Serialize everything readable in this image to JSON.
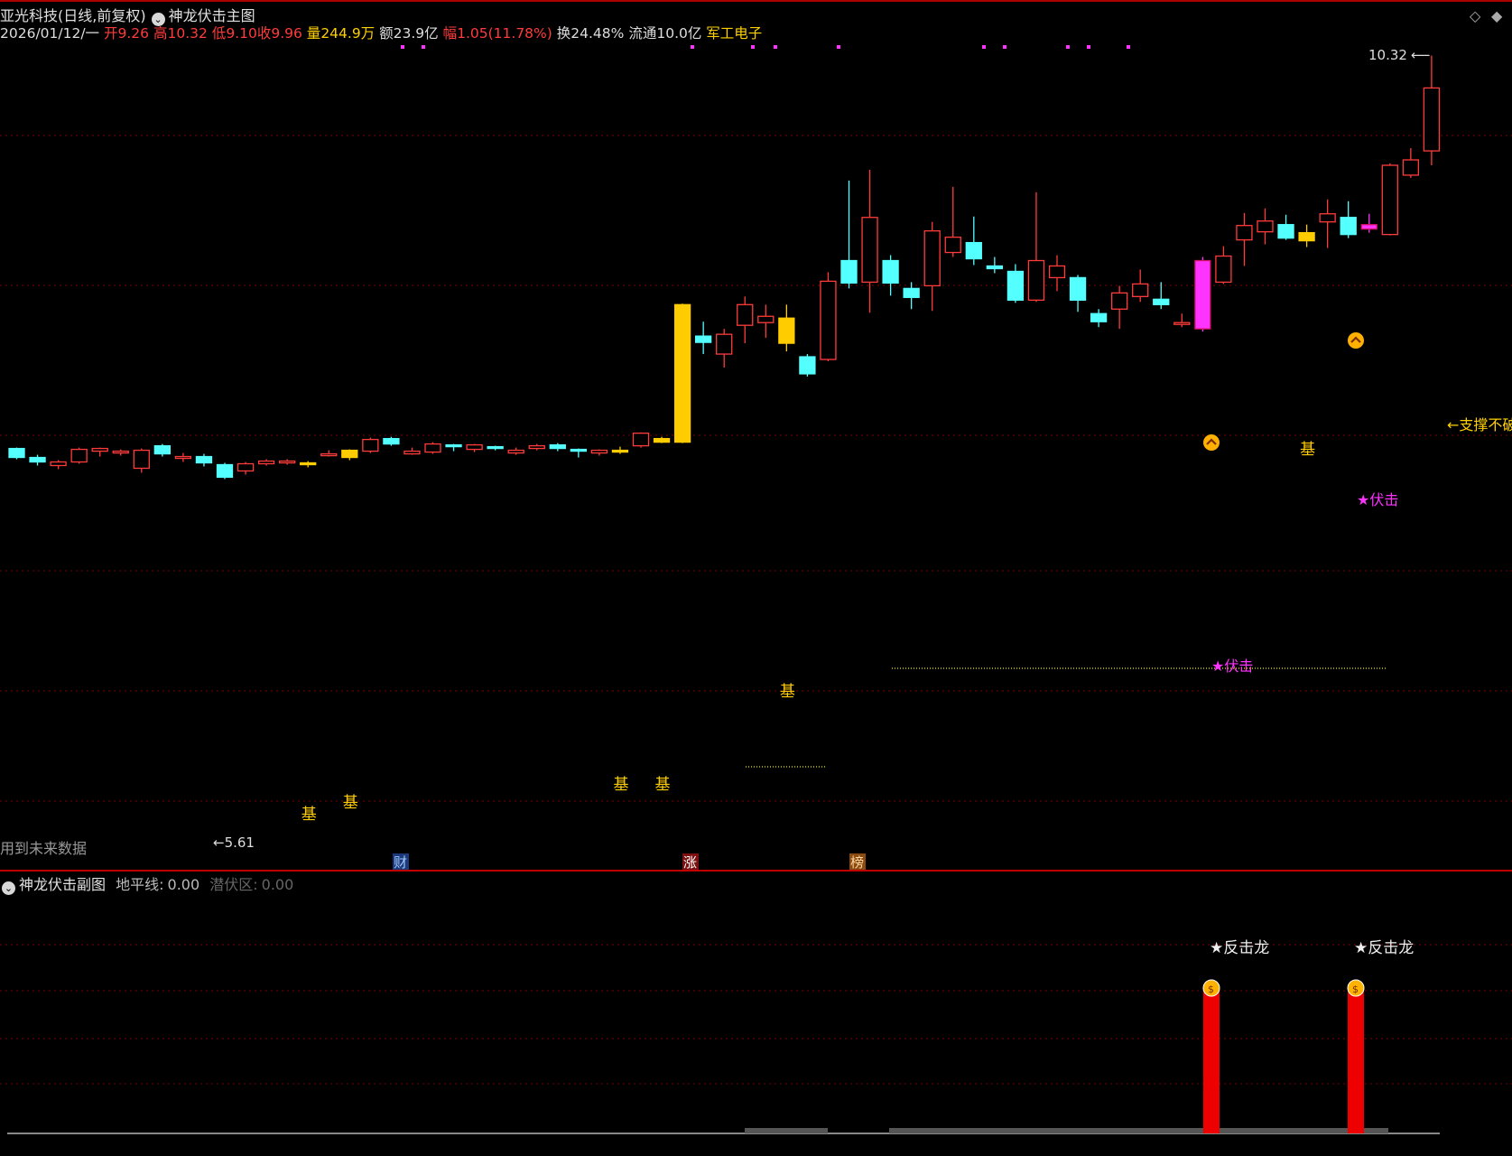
{
  "header": {
    "title": "亚光科技(日线,前复权)",
    "indicator": "神龙伏击主图",
    "date": "2026/01/12/一",
    "open_label": "开",
    "open": "9.26",
    "high_label": "高",
    "high": "10.32",
    "low_label": "低",
    "low": "9.10",
    "close_label": "收",
    "close": "9.96",
    "vol_label": "量",
    "vol": "244.9万",
    "amount_label": "额",
    "amount": "23.9亿",
    "chg_label": "幅",
    "chg": "1.05(11.78%)",
    "turnover_label": "换",
    "turnover": "24.48%",
    "float_label": "流通",
    "float": "10.0亿",
    "sector": "军工电子"
  },
  "main": {
    "high_marker": "10.32",
    "low_marker": "5.61",
    "future_data_note": "用到未来数据",
    "support_note": "←支撑不破",
    "ji_label": "基",
    "fuji_label": "★伏击",
    "news_tags": [
      "财",
      "涨",
      "榜"
    ]
  },
  "sub": {
    "title": "神龙伏击副图",
    "horizon_label": "地平线:",
    "horizon_value": "0.00",
    "hidden_label": "潜伏区:",
    "hidden_value": "0.00",
    "signal_label": "★反击龙"
  },
  "colors": {
    "up": "#ff3b3b",
    "down": "#54ffff",
    "yellow": "#ffcc00",
    "magenta": "#ff33ff",
    "grid": "#7a0000"
  },
  "chart_data": {
    "type": "candlestick",
    "ohlc": [
      [
        5.95,
        5.85,
        5.96,
        5.83
      ],
      [
        5.85,
        5.8,
        5.88,
        5.76
      ],
      [
        5.76,
        5.8,
        5.82,
        5.72
      ],
      [
        5.8,
        5.94,
        5.96,
        5.78
      ],
      [
        5.92,
        5.95,
        5.96,
        5.86
      ],
      [
        5.92,
        5.92,
        5.94,
        5.87
      ],
      [
        5.73,
        5.93,
        5.95,
        5.68
      ],
      [
        5.98,
        5.89,
        6.0,
        5.86
      ],
      [
        5.84,
        5.86,
        5.9,
        5.8
      ],
      [
        5.86,
        5.79,
        5.89,
        5.75
      ],
      [
        5.77,
        5.63,
        5.79,
        5.61
      ],
      [
        5.7,
        5.78,
        5.8,
        5.66
      ],
      [
        5.78,
        5.81,
        5.83,
        5.76
      ],
      [
        5.79,
        5.81,
        5.83,
        5.77
      ],
      [
        5.79,
        5.79,
        5.81,
        5.74
      ],
      [
        5.89,
        5.89,
        5.93,
        5.86
      ],
      [
        5.85,
        5.93,
        5.94,
        5.82
      ],
      [
        5.92,
        6.05,
        6.07,
        5.9
      ],
      [
        6.06,
        6.0,
        6.08,
        5.98
      ],
      [
        5.89,
        5.92,
        5.96,
        5.88
      ],
      [
        5.91,
        6.0,
        6.02,
        5.89
      ],
      [
        5.99,
        5.97,
        6.0,
        5.92
      ],
      [
        5.94,
        5.99,
        6.0,
        5.91
      ],
      [
        5.97,
        5.95,
        5.98,
        5.93
      ],
      [
        5.9,
        5.93,
        5.96,
        5.88
      ],
      [
        5.95,
        5.98,
        6.0,
        5.93
      ],
      [
        5.99,
        5.95,
        6.01,
        5.92
      ],
      [
        5.94,
        5.92,
        5.95,
        5.85
      ],
      [
        5.9,
        5.93,
        5.94,
        5.87
      ],
      [
        5.91,
        5.93,
        5.97,
        5.89
      ],
      [
        5.98,
        6.12,
        6.13,
        5.96
      ],
      [
        6.06,
        6.02,
        6.08,
        6.01
      ],
      [
        6.02,
        7.55,
        7.56,
        6.01
      ],
      [
        7.2,
        7.13,
        7.36,
        7.0
      ],
      [
        7.0,
        7.22,
        7.28,
        6.85
      ],
      [
        7.32,
        7.55,
        7.64,
        7.12
      ],
      [
        7.35,
        7.42,
        7.55,
        7.18
      ],
      [
        7.4,
        7.12,
        7.55,
        7.03
      ],
      [
        6.97,
        6.78,
        7.0,
        6.75
      ],
      [
        6.94,
        7.81,
        7.91,
        6.92
      ],
      [
        8.04,
        7.79,
        8.93,
        7.73
      ],
      [
        7.8,
        8.52,
        9.05,
        7.46
      ],
      [
        8.04,
        7.79,
        8.1,
        7.65
      ],
      [
        7.73,
        7.63,
        7.8,
        7.5
      ],
      [
        7.76,
        8.37,
        8.47,
        7.48
      ],
      [
        8.13,
        8.3,
        8.86,
        8.08
      ],
      [
        8.24,
        8.06,
        8.53,
        7.99
      ],
      [
        7.98,
        7.95,
        8.08,
        7.9
      ],
      [
        7.92,
        7.6,
        8.0,
        7.57
      ],
      [
        7.6,
        8.04,
        8.8,
        7.58
      ],
      [
        7.85,
        7.98,
        8.1,
        7.7
      ],
      [
        7.85,
        7.6,
        7.88,
        7.47
      ],
      [
        7.45,
        7.36,
        7.5,
        7.3
      ],
      [
        7.5,
        7.68,
        7.76,
        7.28
      ],
      [
        7.64,
        7.78,
        7.94,
        7.58
      ],
      [
        7.61,
        7.55,
        7.8,
        7.5
      ],
      [
        7.35,
        7.35,
        7.45,
        7.3
      ],
      [
        7.28,
        8.04,
        8.08,
        7.25
      ],
      [
        7.8,
        8.09,
        8.2,
        7.78
      ],
      [
        8.27,
        8.43,
        8.57,
        7.98
      ],
      [
        8.36,
        8.48,
        8.62,
        8.22
      ],
      [
        8.44,
        8.29,
        8.55,
        8.27
      ],
      [
        8.26,
        8.35,
        8.44,
        8.19
      ],
      [
        8.47,
        8.56,
        8.72,
        8.18
      ],
      [
        8.52,
        8.33,
        8.7,
        8.29
      ],
      [
        8.39,
        8.44,
        8.56,
        8.35
      ],
      [
        8.33,
        9.1,
        9.12,
        8.32
      ],
      [
        8.99,
        9.16,
        9.29,
        8.96
      ],
      [
        9.26,
        9.96,
        10.32,
        9.1
      ]
    ],
    "ylim": [
      5.4,
      10.6
    ],
    "sub_bars": [
      {
        "index": 58,
        "label": "★反击龙"
      },
      {
        "index": 65,
        "label": "★反击龙"
      }
    ]
  }
}
